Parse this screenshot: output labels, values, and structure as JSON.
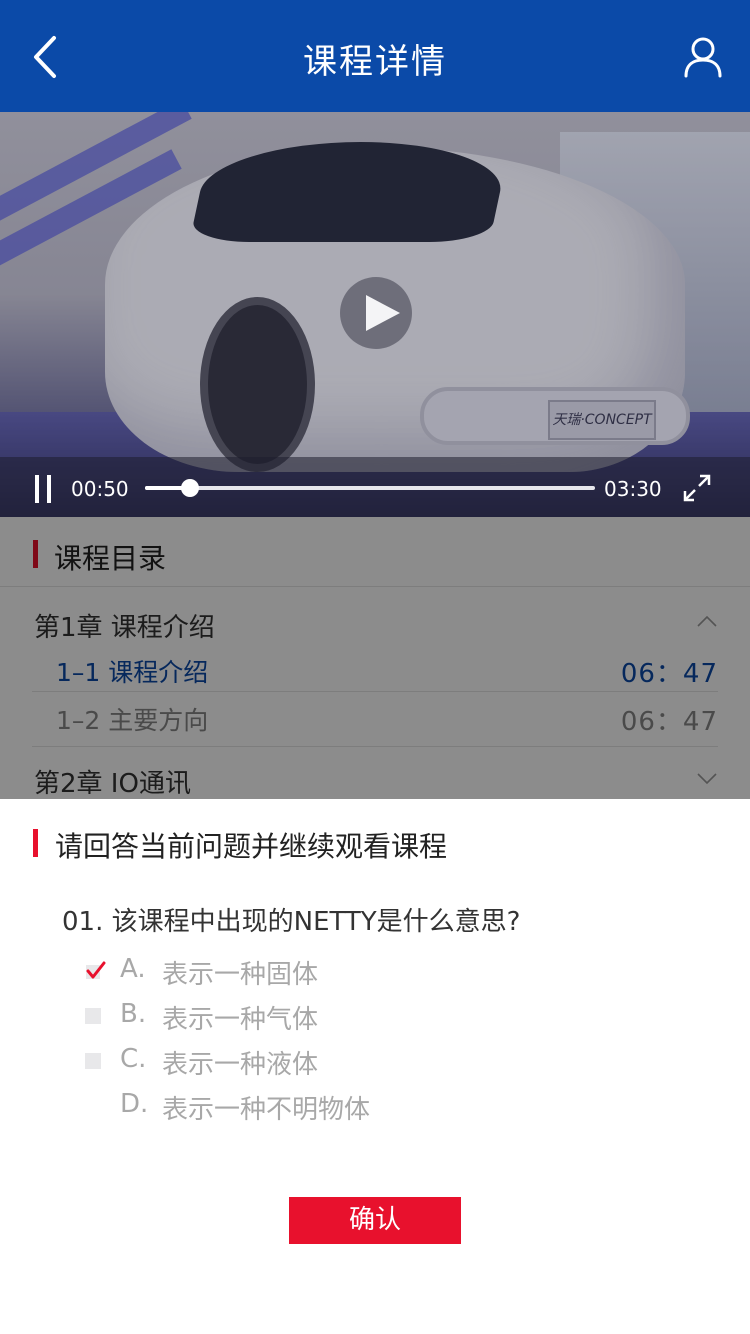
{
  "header": {
    "title": "课程详情",
    "back_icon": "chevron-left-icon",
    "user_icon": "user-icon"
  },
  "video": {
    "plate_text": "天瑞·CONCEPT",
    "current_time": "00:50",
    "total_time": "03:30",
    "progress": 0.1,
    "play_icon": "play-icon",
    "pause_icon": "pause-icon",
    "fullscreen_icon": "fullscreen-icon"
  },
  "catalog": {
    "title": "课程目录",
    "chapters": [
      {
        "title": "第1章  课程介绍",
        "expanded": true,
        "lessons": [
          {
            "title": "1–1  课程介绍",
            "duration": "06：47",
            "active": true
          },
          {
            "title": "1–2  主要方向",
            "duration": "06：47",
            "active": false
          }
        ]
      },
      {
        "title": "第2章  IO通讯",
        "expanded": false,
        "lessons": []
      }
    ]
  },
  "quiz": {
    "title": "请回答当前问题并继续观看课程",
    "question": "01. 该课程中出现的NETTY是什么意思?",
    "options": [
      {
        "letter": "A.",
        "text": "表示一种固体",
        "checked": true
      },
      {
        "letter": "B.",
        "text": "表示一种气体",
        "checked": false
      },
      {
        "letter": "C.",
        "text": "表示一种液体",
        "checked": false
      },
      {
        "letter": "D.",
        "text": "表示一种不明物体",
        "checked": false
      }
    ],
    "confirm_label": "确认"
  },
  "colors": {
    "header_bg": "#0b4aa8",
    "accent_red": "#e8112d",
    "active_blue": "#0b4aa8"
  }
}
